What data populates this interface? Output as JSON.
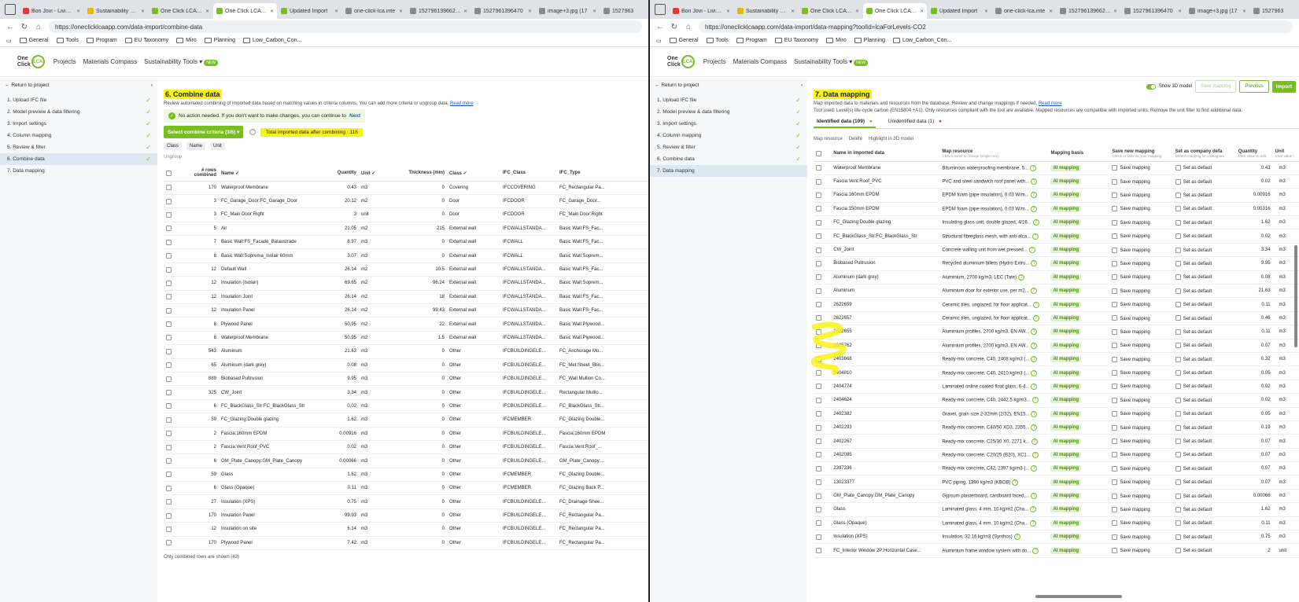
{
  "left": {
    "tabs": [
      {
        "label": "Bon Jovi - Livin' On",
        "color": "#e33"
      },
      {
        "label": "Sustainability Con",
        "color": "#e8b900"
      },
      {
        "label": "One Click LCA - L",
        "color": "#78be20"
      },
      {
        "label": "One Click LCA - L",
        "color": "#78be20",
        "active": true
      },
      {
        "label": "Updated Import",
        "color": "#78be20"
      },
      {
        "label": "one-click-lca.inte",
        "color": "#888"
      },
      {
        "label": "15279613966250",
        "color": "#888"
      },
      {
        "label": "1527961396470",
        "color": "#888"
      },
      {
        "label": "image+3.jpg (17",
        "color": "#888"
      },
      {
        "label": "1527963",
        "color": "#888"
      }
    ],
    "url": "https://oneclicklcaapp.com/data-import/combine-data",
    "title": "6. Combine data",
    "desc": "Review automated combining of imported data based on matching values in criteria columns. You can add more criteria or ungroup data.",
    "read_more": "Read more",
    "notice": "No action needed. If you don't want to make changes, you can continue to",
    "next": "Next",
    "criteria_btn": "Select combine criteria (3/6) ▾",
    "total": "Total imported data after combining : 118",
    "chips": [
      "Class",
      "Name",
      "Unit"
    ],
    "ungroup": "Ungroup",
    "headers": [
      "# rows combined",
      "Name ✓",
      "Quantity",
      "Unit ✓",
      "Thickness (mm)",
      "Class ✓",
      "IFC_Class",
      "IFC_Type"
    ],
    "rows": [
      [
        "170",
        "Waterproof Membrane",
        "0.43",
        "m3",
        "0",
        "Covering",
        "IFCCOVERING",
        "FC_Rectangular Pa..."
      ],
      [
        "3",
        "FC_Garage_Door:FC_Garage_Door",
        "20.12",
        "m2",
        "0",
        "Door",
        "IFCDOOR",
        "FC_Garage_Door..."
      ],
      [
        "3",
        "FC_Main Door:Right",
        "3",
        "unit",
        "0",
        "Door",
        "IFCDOOR",
        "FC_Main Door:Right"
      ],
      [
        "5",
        "Air",
        "21.05",
        "m2",
        "215",
        "External wall",
        "IFCWALLSTANDA...",
        "Basic Wall:FS_Fac..."
      ],
      [
        "7",
        "Basic Wall:FS_Facade_Balaustrade",
        "8.97",
        "m3",
        "0",
        "External wall",
        "IFCWALL",
        "Basic Wall:FS_Fac..."
      ],
      [
        "8",
        "Basic Wall:Soprema_Isolair 60mm",
        "3.07",
        "m3",
        "0",
        "External wall",
        "IFCWALL",
        "Basic Wall:Soprem..."
      ],
      [
        "12",
        "Default Wall",
        "26.14",
        "m2",
        "10.5",
        "External wall",
        "IFCWALLSTANDA...",
        "Basic Wall:FS_Fac..."
      ],
      [
        "12",
        "Insulation (Isolair)",
        "69.65",
        "m2",
        "96.24",
        "External wall",
        "IFCWALLSTANDA...",
        "Basic Wall:Soprem..."
      ],
      [
        "12",
        "Insulation Joint",
        "26.14",
        "m2",
        "18",
        "External wall",
        "IFCWALLSTANDA...",
        "Basic Wall:FS_Fac..."
      ],
      [
        "12",
        "Insulation Panel",
        "26.14",
        "m2",
        "99.43",
        "External wall",
        "IFCWALLSTANDA...",
        "Basic Wall:FS_Fac..."
      ],
      [
        "8",
        "Plywood Panel",
        "50.95",
        "m2",
        "22",
        "External wall",
        "IFCWALLSTANDA...",
        "Basic Wall:Plywood..."
      ],
      [
        "8",
        "Waterproof Membrane",
        "50.95",
        "m2",
        "1.5",
        "External wall",
        "IFCWALLSTANDA...",
        "Basic Wall:Plywood..."
      ],
      [
        "543",
        "Aluminum",
        "21.63",
        "m3",
        "0",
        "Other",
        "IFCBUILDINGELE...",
        "FC_Anchorage Mo..."
      ],
      [
        "65",
        "Aluminum (dark grey)",
        "0.08",
        "m3",
        "0",
        "Other",
        "IFCBUILDINGELE...",
        "FC_Met:Sheet_Blin..."
      ],
      [
        "889",
        "Biobased Pultrusion",
        "9.95",
        "m3",
        "0",
        "Other",
        "IFCBUILDINGELE...",
        "FC_Wall Mullion Co..."
      ],
      [
        "325",
        "CW_Joint",
        "3.34",
        "m3",
        "0",
        "Other",
        "IFCBUILDINGELE...",
        "Rectangular Mullio..."
      ],
      [
        "6",
        "FC_BlackGlass_Str:FC_BlackGlass_Str",
        "0.02",
        "m3",
        "0",
        "Other",
        "IFCBUILDINGELE...",
        "FC_BlackGlass_Str..."
      ],
      [
        "59",
        "FC_Glazing:Double glazing",
        "1.62",
        "m3",
        "0",
        "Other",
        "IFCMEMBER",
        "FC_Glazing Double..."
      ],
      [
        "2",
        "Fascia:160mm EPDM",
        "0.00916",
        "m3",
        "0",
        "Other",
        "IFCBUILDINGELE...",
        "Fascia:160mm EPDM"
      ],
      [
        "2",
        "Fascia:Vent Roof_PVC",
        "0.02",
        "m3",
        "0",
        "Other",
        "IFCBUILDINGELE...",
        "Fascia:Vent:Roof_..."
      ],
      [
        "6",
        "GM_Plate_Canopy:GM_Plate_Canopy",
        "0.00066",
        "m3",
        "0",
        "Other",
        "IFCBUILDINGELE...",
        "GM_Plate_Canopy:..."
      ],
      [
        "59",
        "Glass",
        "1.62",
        "m3",
        "0",
        "Other",
        "IFCMEMBER",
        "FC_Glazing Double..."
      ],
      [
        "6",
        "Glass (Opaque)",
        "0.11",
        "m3",
        "0",
        "Other",
        "IFCMEMBER",
        "FC_Glazing Back P..."
      ],
      [
        "27",
        "Insulation (XPS)",
        "0.75",
        "m3",
        "0",
        "Other",
        "IFCBUILDINGELE...",
        "FC_Drainage Shee..."
      ],
      [
        "170",
        "Insulation Panel",
        "99.93",
        "m3",
        "0",
        "Other",
        "IFCBUILDINGELE...",
        "FC_Rectangular Pa..."
      ],
      [
        "12",
        "Insulation on site",
        "6.14",
        "m3",
        "0",
        "Other",
        "IFCBUILDINGELE...",
        "FC_Rectangular Pa..."
      ],
      [
        "170",
        "Plywood Panel",
        "7.42",
        "m3",
        "0",
        "Other",
        "IFCBUILDINGELE...",
        "FC_Rectangular Pa..."
      ]
    ],
    "footnote": "Only combined rows are shown (43)"
  },
  "right": {
    "tabs": [
      {
        "label": "Bon Jovi - Livin' On",
        "color": "#e33"
      },
      {
        "label": "Sustainability Con",
        "color": "#e8b900"
      },
      {
        "label": "One Click LCA - L",
        "color": "#78be20"
      },
      {
        "label": "One Click LCA - L",
        "color": "#78be20",
        "active": true
      },
      {
        "label": "Updated Import",
        "color": "#78be20"
      },
      {
        "label": "one-click-lca.inte",
        "color": "#888"
      },
      {
        "label": "15279613966250",
        "color": "#888"
      },
      {
        "label": "1527961396470",
        "color": "#888"
      },
      {
        "label": "image+3.jpg (17",
        "color": "#888"
      },
      {
        "label": "1527963",
        "color": "#888"
      }
    ],
    "url": "https://oneclicklcaapp.com/data-import/data-mapping?toolId=lcaForLevels-CO2",
    "title": "7. Data mapping",
    "desc": "Map imported data to materials and resources from the database. Review and change mappings if needed.",
    "read_more": "Read more",
    "tool_used": "Tool used: Level(s) life-cycle carbon (EN15804 +A1). Only resources compliant with the tool are available. Mapped resources are compatible with imported units. Remove the unit filter to find additional data.",
    "show3d": "Show 3D model",
    "save_mapping": "Save mapping",
    "previous": "Previous",
    "import": "Import",
    "tab_identified": "Identified data (109)",
    "tab_unidentified": "Unidentified data (1)",
    "actions": [
      "Map resource",
      "Delete",
      "Highlight in 3D model"
    ],
    "headers": [
      "Name in imported data",
      "Map resource",
      "Mapping basis",
      "Save new mapping",
      "Set as company defa",
      "Quantity",
      "Unit"
    ],
    "header_subs": [
      "",
      "Click a name to change (single row)",
      "",
      "Check to save as your mapping",
      "Default mapping for colleagues",
      "Click value to edit",
      "Click value t"
    ],
    "ai_label": "AI mapping",
    "save_label": "Save mapping",
    "default_label": "Set as default",
    "rows": [
      [
        "Waterproof Membrane",
        "Bituminous waterproofing membrane, 5...",
        "0.43",
        "m3"
      ],
      [
        "Fascia:Vent:Roof_PVC",
        "PVC and steel sandwich roof panel with...",
        "0.02",
        "m3"
      ],
      [
        "Fascia:160mm EPDM",
        "EPDM foam (pipe insulation), 0.03 W/m...",
        "0.00916",
        "m3"
      ],
      [
        "Fascia:150mm EPDM",
        "EPDM foam (pipe insulation), 0.03 W/m...",
        "0.00316",
        "m3"
      ],
      [
        "FC_Glazing:Double glazing",
        "Insulating glass unit, double glazed, 4/16...",
        "1.62",
        "m3"
      ],
      [
        "FC_BlackGlass_Str:FC_BlackGlass_Str",
        "Structural fibreglass mesh, with anti-alca...",
        "0.02",
        "m3"
      ],
      [
        "CW_Joint",
        "Concrete walling unit from wet pressed...",
        "3.34",
        "m3"
      ],
      [
        "Biobased Pultrusion",
        "Recycled aluminium billets (Hydro Extru...",
        "9.95",
        "m3"
      ],
      [
        "Aluminum (dark grey)",
        "Aluminium, 2700 kg/m3, LEC (Tate)",
        "0.08",
        "m3"
      ],
      [
        "Aluminum",
        "Aluminium door for exterior use, per m2...",
        "21.63",
        "m3"
      ],
      [
        "2622659",
        "Ceramic tiles, unglazed, for floor applicat...",
        "0.11",
        "m3"
      ],
      [
        "2622657",
        "Ceramic tiles, unglazed, for floor applicat...",
        "0.46",
        "m3"
      ],
      [
        "2622655",
        "Aluminium profiles, 2700 kg/m3, EN AW...",
        "0.11",
        "m3"
      ],
      [
        "2605762",
        "Aluminium profiles, 2700 kg/m3, EN AW...",
        "0.07",
        "m3"
      ],
      [
        "2403668",
        "Ready-mix concrete, C40, 2408 kg/m3 (...",
        "0.32",
        "m3"
      ],
      [
        "2404810",
        "Ready-mix concrete, C40, 2410 kg/m3 (...",
        "0.05",
        "m3"
      ],
      [
        "2404774",
        "Laminated online coated float glass, 6-4...",
        "0.02",
        "m3"
      ],
      [
        "2404624",
        "Ready-mix concrete, C40, 2442.5 kg/m3...",
        "0.02",
        "m3"
      ],
      [
        "2402382",
        "Gravel, grain size 2-32mm (2/32), EN15...",
        "0.05",
        "m3"
      ],
      [
        "2402293",
        "Ready-mix concrete, C40/50 XD3, 2355...",
        "0.19",
        "m3"
      ],
      [
        "2402267",
        "Ready-mix concrete, C25/30 X0, 2271 k...",
        "0.07",
        "m3"
      ],
      [
        "2402085",
        "Ready-mix concrete, C20/25 (B20), XC1...",
        "0.07",
        "m3"
      ],
      [
        "2397336",
        "Ready-mix concrete, C42, 2397 kg/m3 (...",
        "0.07",
        "m3"
      ],
      [
        "13023377",
        "PVC piping, 1390 kg/m3 (KBOB)",
        "0.07",
        "m3"
      ],
      [
        "GM_Plate_Canopy:GM_Plate_Canopy",
        "Gypsum plasterboard, cardboard faced,...",
        "0.00066",
        "m3"
      ],
      [
        "Glass",
        "Laminated glass, 4 mm, 10 kg/m2 (Cha...",
        "1.62",
        "m3"
      ],
      [
        "Glass (Opaque)",
        "Laminated glass, 4 mm, 10 kg/m2 (Cha...",
        "0.11",
        "m3"
      ],
      [
        "Insulation (XPS)",
        "Insulation, 32.16 kg/m3 (Synthos)",
        "0.75",
        "m3"
      ],
      [
        "FC_Interior Window 2P:Horizontal:Case...",
        "Aluminium frame window system with do...",
        "2",
        "unit"
      ]
    ]
  },
  "common": {
    "bookmarks": [
      "General",
      "Tools",
      "Program",
      "EU Taxonomy",
      "Miro",
      "Planning",
      "Low_Carbon_Con..."
    ],
    "logo_top": "One",
    "logo_bottom": "Click",
    "logo_mark": "LCA",
    "nav": [
      "Projects",
      "Materials Compass",
      "Sustainability Tools"
    ],
    "new_badge": "NEW",
    "return": "Return to project",
    "steps": [
      "1. Upload IFC file",
      "2. Model preview & data filtering",
      "3. Import settings",
      "4. Column mapping",
      "5. Review & filter",
      "6. Combine data",
      "7. Data mapping"
    ],
    "highlight_color": "#f7f318",
    "accent": "#78be20"
  }
}
